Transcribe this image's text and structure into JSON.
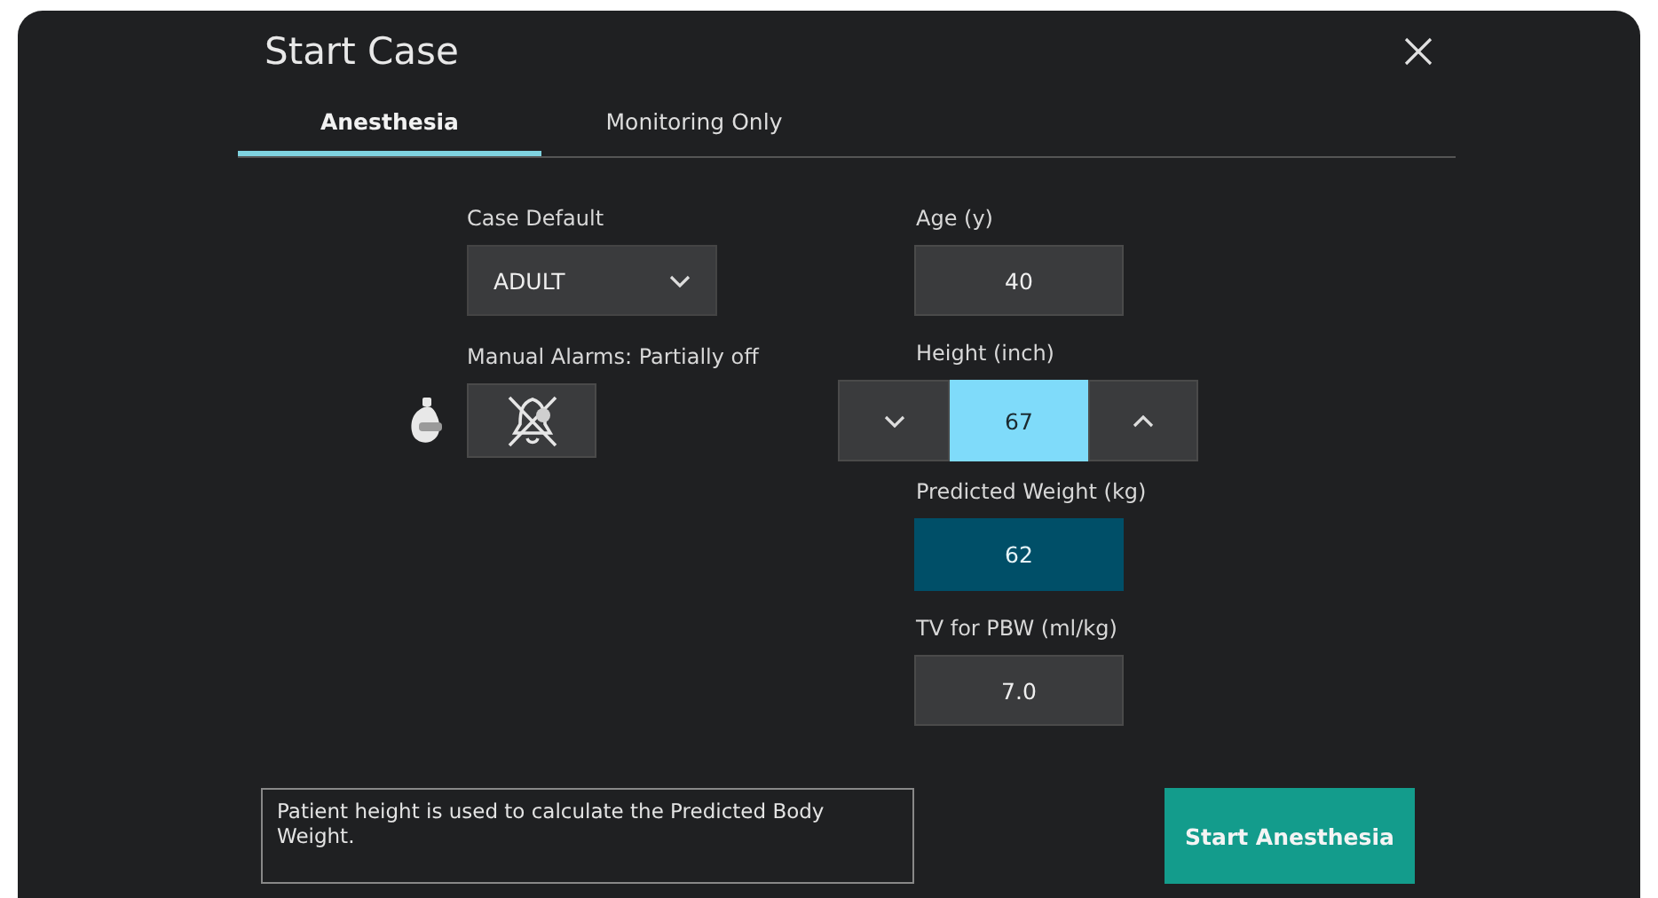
{
  "dialog": {
    "title": "Start Case"
  },
  "tabs": [
    {
      "label": "Anesthesia",
      "selected": true
    },
    {
      "label": "Monitoring Only",
      "selected": false
    }
  ],
  "case_default": {
    "label": "Case Default",
    "value": "ADULT"
  },
  "manual_alarms": {
    "label": "Manual Alarms: Partially off"
  },
  "fields": [
    {
      "kind": "input",
      "label": "Age (y)",
      "value": "40"
    },
    {
      "kind": "stepper",
      "label": "Height (inch)",
      "value": "67"
    },
    {
      "kind": "computed",
      "label": "Predicted Weight (kg)",
      "value": "62"
    },
    {
      "kind": "input",
      "label": "TV for PBW (ml/kg)",
      "value": "7.0"
    }
  ],
  "info_text": "Patient height is used to calculate the Predicted Body Weight.",
  "start_button": {
    "label": "Start Anesthesia"
  }
}
